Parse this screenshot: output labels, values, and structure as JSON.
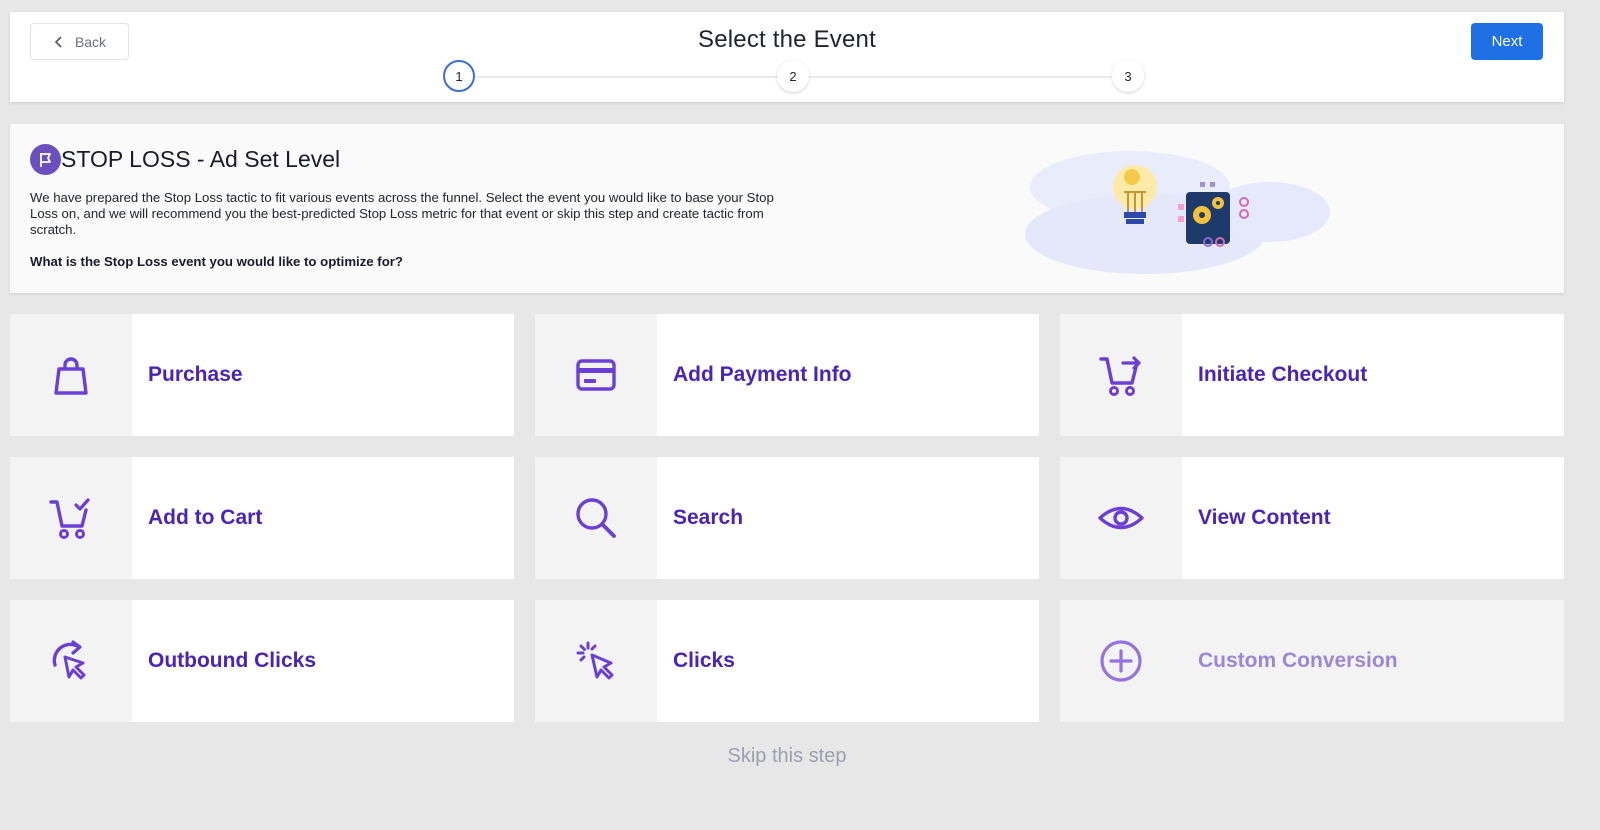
{
  "header": {
    "back_label": "Back",
    "title": "Select the Event",
    "next_label": "Next",
    "steps": [
      "1",
      "2",
      "3"
    ],
    "active_step": 1
  },
  "info": {
    "title": "STOP LOSS - Ad Set Level",
    "description": "We have prepared the Stop Loss tactic to fit various events across the funnel. Select the event you would like to base your Stop Loss on, and we will recommend you the best-predicted Stop Loss metric for that event or skip this step and create tactic from scratch.",
    "question": "What is the Stop Loss event you would like to optimize for?"
  },
  "events": [
    {
      "label": "Purchase",
      "icon": "shopping-bag-icon"
    },
    {
      "label": "Add Payment Info",
      "icon": "credit-card-icon"
    },
    {
      "label": "Initiate Checkout",
      "icon": "cart-arrow-icon"
    },
    {
      "label": "Add to Cart",
      "icon": "cart-check-icon"
    },
    {
      "label": "Search",
      "icon": "search-icon"
    },
    {
      "label": "View Content",
      "icon": "eye-icon"
    },
    {
      "label": "Outbound Clicks",
      "icon": "outbound-click-icon"
    },
    {
      "label": "Clicks",
      "icon": "click-cursor-icon"
    },
    {
      "label": "Custom Conversion",
      "icon": "plus-circle-icon",
      "disabled": true
    }
  ],
  "skip_label": "Skip this step",
  "colors": {
    "accent": "#4a23b8",
    "icon": "#6b3fd6",
    "primary_button": "#1f6fe5",
    "disabled_label": "#9b87d6"
  }
}
